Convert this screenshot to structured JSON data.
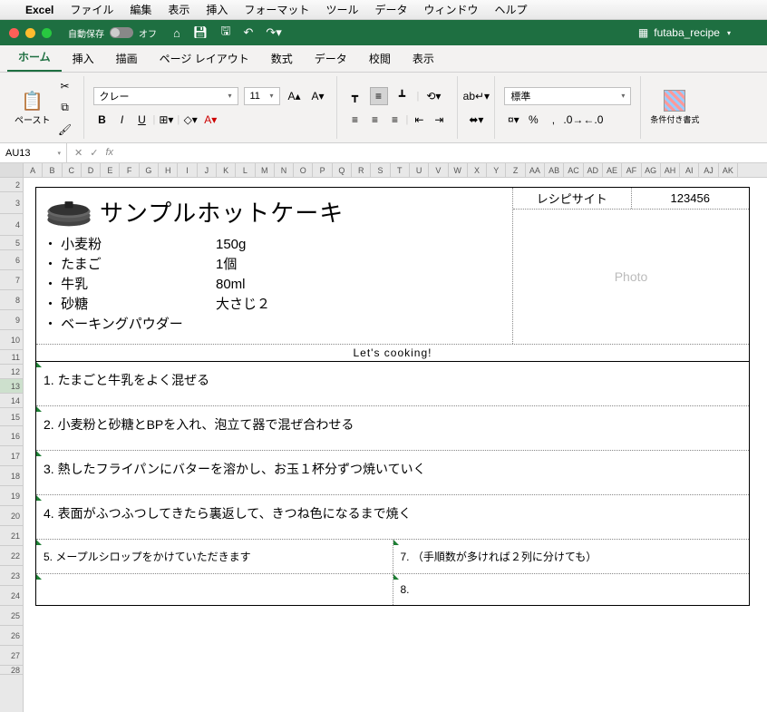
{
  "mac_menu": {
    "app": "Excel",
    "items": [
      "ファイル",
      "編集",
      "表示",
      "挿入",
      "フォーマット",
      "ツール",
      "データ",
      "ウィンドウ",
      "ヘルプ"
    ]
  },
  "titlebar": {
    "autosave_label": "自動保存",
    "autosave_state": "オフ",
    "filename": "futaba_recipe"
  },
  "tabs": [
    "ホーム",
    "挿入",
    "描画",
    "ページ レイアウト",
    "数式",
    "データ",
    "校閲",
    "表示"
  ],
  "ribbon": {
    "paste": "ペースト",
    "font_name": "クレー",
    "font_size": "11",
    "number_format": "標準",
    "cond_fmt": "条件付き書式"
  },
  "formula": {
    "name_box": "AU13",
    "fx": "fx",
    "value": ""
  },
  "cols": [
    "A",
    "B",
    "C",
    "D",
    "E",
    "F",
    "G",
    "H",
    "I",
    "J",
    "K",
    "L",
    "M",
    "N",
    "O",
    "P",
    "Q",
    "R",
    "S",
    "T",
    "U",
    "V",
    "W",
    "X",
    "Y",
    "Z",
    "AA",
    "AB",
    "AC",
    "AD",
    "AE",
    "AF",
    "AG",
    "AH",
    "AI",
    "AJ",
    "AK"
  ],
  "rows": [
    2,
    3,
    4,
    5,
    6,
    7,
    8,
    9,
    10,
    11,
    12,
    13,
    14,
    15,
    16,
    17,
    18,
    19,
    20,
    21,
    22,
    23,
    24,
    25,
    26,
    27,
    28
  ],
  "recipe": {
    "meta_label": "レシピサイト",
    "meta_value": "123456",
    "photo_placeholder": "Photo",
    "title": "サンプルホットケーキ",
    "ingredients": [
      {
        "n": "・ 小麦粉",
        "q": "150g"
      },
      {
        "n": "・ たまご",
        "q": "1個"
      },
      {
        "n": "・ 牛乳",
        "q": "80ml"
      },
      {
        "n": "・ 砂糖",
        "q": "大さじ２"
      },
      {
        "n": "・ ベーキングパウダー",
        "q": ""
      }
    ],
    "cook_label": "Let's cooking!",
    "steps_full": [
      "1.  たまごと牛乳をよく混ぜる",
      "2.  小麦粉と砂糖とBPを入れ、泡立て器で混ぜ合わせる",
      "3.  熱したフライパンにバターを溶かし、お玉１杯分ずつ焼いていく",
      "4.  表面がふつふつしてきたら裏返して、きつね色になるまで焼く"
    ],
    "steps_split": [
      {
        "l": "5.  メープルシロップをかけていただきます",
        "r": "7.  （手順数が多ければ２列に分けても）"
      },
      {
        "l": "",
        "r": "8."
      }
    ]
  }
}
